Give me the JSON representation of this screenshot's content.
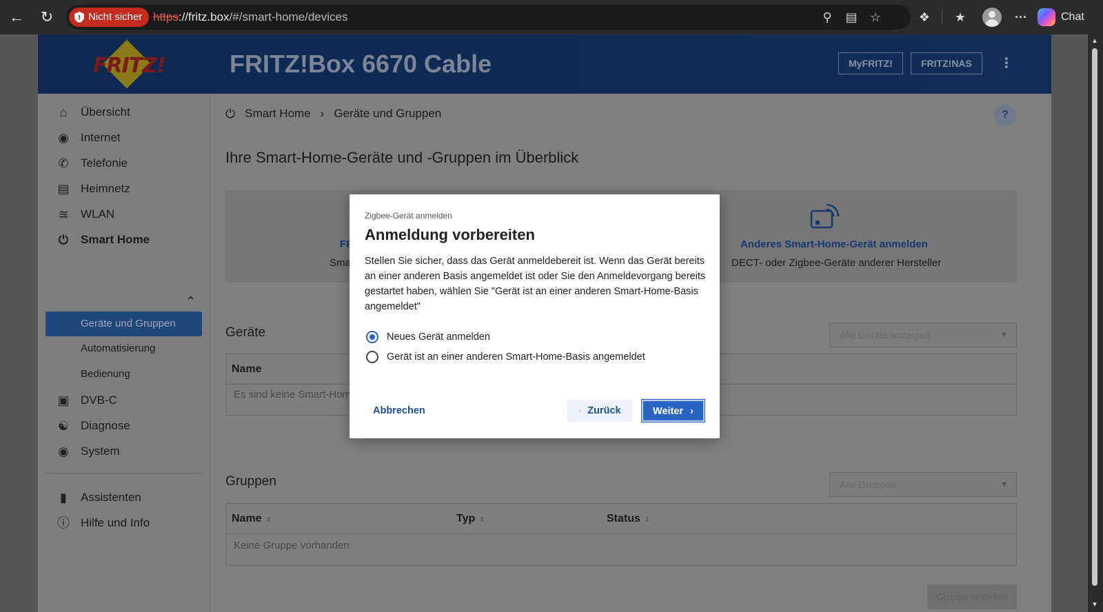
{
  "browser": {
    "security_label": "Nicht sicher",
    "url_scheme": "https",
    "url_host": "://fritz.box",
    "url_path": "/#/smart-home/devices",
    "chat_label": "Chat"
  },
  "header": {
    "logo_text": "FRITZ!",
    "product": "FRITZ!Box 6670 Cable",
    "buttons": [
      "MyFRITZ!",
      "FRITZ!NAS"
    ]
  },
  "sidebar": {
    "items": [
      {
        "label": "Übersicht",
        "icon": "home-icon"
      },
      {
        "label": "Internet",
        "icon": "globe-icon"
      },
      {
        "label": "Telefonie",
        "icon": "phone-icon"
      },
      {
        "label": "Heimnetz",
        "icon": "network-icon"
      },
      {
        "label": "WLAN",
        "icon": "wifi-icon"
      },
      {
        "label": "Smart Home",
        "icon": "smarthome-icon"
      }
    ],
    "smart_home_sub": [
      "Geräte und Gruppen",
      "Automatisierung",
      "Bedienung"
    ],
    "items2": [
      {
        "label": "DVB-C",
        "icon": "tv-icon"
      },
      {
        "label": "Diagnose",
        "icon": "diagnose-icon"
      },
      {
        "label": "System",
        "icon": "system-icon"
      }
    ],
    "items3": [
      {
        "label": "Assistenten",
        "icon": "assistant-icon"
      },
      {
        "label": "Hilfe und Info",
        "icon": "help-icon"
      }
    ]
  },
  "main": {
    "breadcrumb": [
      "Smart Home",
      "Geräte und Gruppen"
    ],
    "help": "?",
    "title": "Ihre Smart-Home-Geräte und -Gruppen im Überblick",
    "tile_left_link": "FR",
    "tile_left_sub": "Sma",
    "tile_right_link": "Anderes Smart-Home-Gerät anmelden",
    "tile_right_sub": "DECT- oder Zigbee-Geräte anderer Hersteller",
    "devices_title": "Geräte",
    "devices_filter": "Alle Geräte anzeigen",
    "devices_col_name": "Name",
    "devices_empty": "Es sind keine Smart-Home-",
    "groups_title": "Gruppen",
    "groups_filter": "Alle Gruppen",
    "groups_cols": [
      "Name",
      "Typ",
      "Status"
    ],
    "groups_empty": "Keine Gruppe vorhanden",
    "create_group": "Gruppe erstellen"
  },
  "modal": {
    "kicker": "Zigbee-Gerät anmelden",
    "title": "Anmeldung vorbereiten",
    "text": "Stellen Sie sicher, dass das Gerät anmeldebereit ist. Wenn das Gerät bereits an einer anderen Basis angemeldet ist oder Sie den Anmeldevorgang bereits gestartet haben, wählen Sie \"Gerät ist an einer anderen Smart-Home-Basis angemeldet\"",
    "options": [
      {
        "label": "Neues Gerät anmelden",
        "selected": true
      },
      {
        "label": "Gerät ist an einer anderen Smart-Home-Basis angemeldet",
        "selected": false
      }
    ],
    "cancel": "Abbrechen",
    "back": "Zurück",
    "next": "Weiter"
  },
  "colors": {
    "primary": "#2a64c3",
    "header_bg": "#0e2a52",
    "not_secure": "#c42b1c"
  }
}
